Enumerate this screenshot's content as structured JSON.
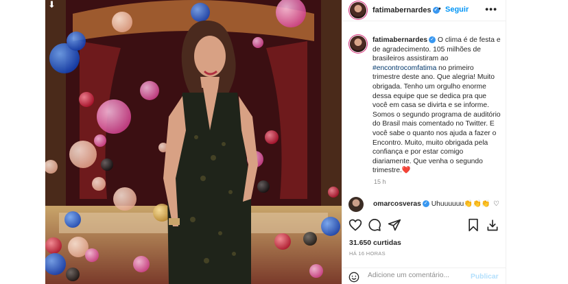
{
  "post": {
    "username": "fatimabernardes",
    "follow_label": "Seguir",
    "more_label": "•••",
    "separator": "•",
    "caption_lines_a": "O clima é de festa e de agradecimento. 105 milhões de brasileiros assistiram ao ",
    "hashtag": "#encontrocomfatima",
    "caption_lines_b": " no primeiro trimestre deste ano. Que alegria! Muito obrigada. Tenho um orgulho enorme dessa equipe que se dedica pra que você em casa se divirta e se informe. Somos o segundo programa de auditório do Brasil mais comentado no Twitter. E você sabe o quanto nos ajuda a fazer o Encontro. Muito, muito obrigada pela confiança e por estar comigo diariamente. Que venha o segundo trimestre.",
    "caption_emoji": "❤️",
    "caption_time": "15 h",
    "comment": {
      "username": "omarcosveras",
      "text": "Uhuuuuuu👏👏👏"
    },
    "likes": "31.650 curtidas",
    "posted_ago": "HÁ 16 HORAS",
    "add_comment_placeholder": "Adicione um comentário...",
    "publish_label": "Publicar"
  },
  "icons": {
    "verified": "verified-badge-icon",
    "like": "heart-icon",
    "comment": "comment-icon",
    "share": "send-icon",
    "save": "bookmark-icon",
    "download": "download-icon",
    "emoji": "smiley-icon"
  },
  "colors": {
    "link_blue": "#0095f6",
    "hashtag": "#00376b",
    "muted": "#8e8e8e",
    "text": "#262626"
  }
}
